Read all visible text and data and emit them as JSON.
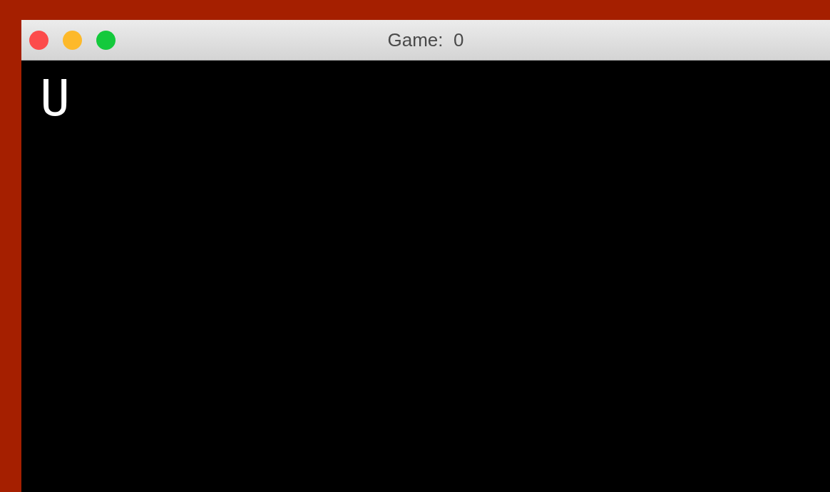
{
  "window": {
    "title": "Game:  0"
  },
  "canvas": {
    "text": "U"
  }
}
